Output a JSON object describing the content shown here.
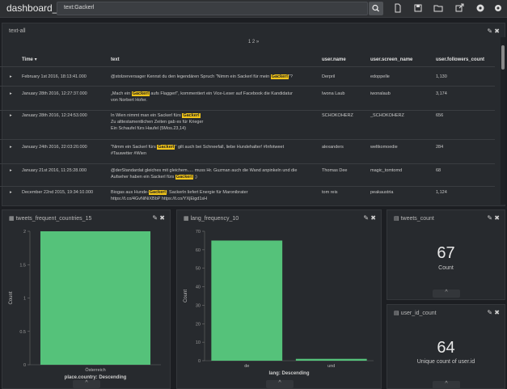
{
  "dashboard": {
    "title": "dashboard_1",
    "search_value": "text:Gackerl"
  },
  "toolbar_icons": [
    "search-icon",
    "new-document-icon",
    "save-icon",
    "open-folder-icon",
    "share-icon",
    "settings-icon",
    "gear-icon"
  ],
  "text_all": {
    "title": "text-all",
    "pager": "1  2  »",
    "columns": [
      "Time ▾",
      "text",
      "user.name",
      "user.screen_name",
      "user.followers_count"
    ],
    "rows": [
      {
        "time": "February 1st 2016, 18:13:41.000",
        "text_before": "@stolzerversager Kennst du den legendären Spruch \"Nimm ein Sackerl für mein ",
        "highlight": "Gackerl",
        "text_after": "\"?",
        "text_line2": "",
        "text_line3": "",
        "name": "Derpril",
        "screen": "edoppelle",
        "followers": "1,130"
      },
      {
        "time": "January 28th 2016, 12:27:37.000",
        "text_before": "„Mach ein ",
        "highlight": "Gackerl",
        "text_after": " aufs Flaggerl\", kommentiert ein Vice-Leser auf Facebook die Kandidatur",
        "text_line2": "von Norbert Hofer.",
        "text_line3": "",
        "name": "Iwona Laub",
        "screen": "iwonalaub",
        "followers": "3,174"
      },
      {
        "time": "January 28th 2016, 12:24:53.000",
        "text_before": "In Wien nimmt man ein Sackerl fürs ",
        "highlight": "Gackerl",
        "text_after": "",
        "text_line2": "Zu alttestamentlichen Zeiten gab es für Krieger",
        "text_line3": "Ein Schaufel fürs Haufel  (5Mos.23,14)",
        "name": "SCHOKOHERZ",
        "screen": "_SCHOKOHERZ",
        "followers": "656"
      },
      {
        "time": "January 24th 2016, 22:03:20.000",
        "text_before": "\"Nimm ein Sackerl fürs ",
        "highlight": "Gackerl",
        "text_after": "\" gilt auch bei Schneefall, liebe Hundehalter! #Infotweet",
        "text_line2": "#Tauwetter #Wien",
        "text_line3": "",
        "name": "alexanders",
        "screen": "weltkomoedie",
        "followers": "284"
      },
      {
        "time": "January 21st 2016, 11:25:28.000",
        "text_before": "@derStandardat gleiches mit gleichem..... muss Hr. Guzman auch die Wand anpinkeln und die",
        "highlight": "",
        "text_after": "",
        "text_line2": "Aufseher haben ein Sackerl fürs ",
        "line2_highlight": "Gackerl",
        "line2_after": " ;)",
        "text_line3": "",
        "name": "Thomas Dee",
        "screen": "magic_tomtomd",
        "followers": "68"
      },
      {
        "time": "December 22nd 2015, 19:34:10.000",
        "text_before": "Biogas aus Hunde-",
        "highlight": "Gackerl",
        "text_after": ": Sackerln liefert Energie für Maronibrater",
        "text_line2": "https://t.co/4GvNiNiXBbP https://t.co/YXjEigd1sH",
        "text_line3": "",
        "name": "tom reis",
        "screen": "peakaustria",
        "followers": "1,124"
      }
    ]
  },
  "countries_panel": {
    "title": "tweets_frequent_countries_15",
    "ylabel": "Count",
    "xlabel": "place.country: Descending"
  },
  "lang_panel": {
    "title": "lang_frequency_10",
    "ylabel": "Count",
    "xlabel": "lang: Descending"
  },
  "tweets_count": {
    "title": "tweets_count",
    "value": "67",
    "label": "Count"
  },
  "user_id_count": {
    "title": "user_id_count",
    "value": "64",
    "label": "Unique count of user.id"
  },
  "colors": {
    "bar": "#55c27a",
    "highlight": "#f0c419",
    "background": "#1c1e22",
    "panel": "#272a2e"
  },
  "chart_data": [
    {
      "type": "bar",
      "categories": [
        "Österreich"
      ],
      "values": [
        2
      ],
      "xlabel": "place.country: Descending",
      "ylabel": "Count",
      "yticks": [
        "0",
        "0.5",
        "1",
        "1.5",
        "2"
      ],
      "ylim": [
        0,
        2
      ]
    },
    {
      "type": "bar",
      "categories": [
        "de",
        "und"
      ],
      "values": [
        65,
        1
      ],
      "xlabel": "lang: Descending",
      "ylabel": "Count",
      "yticks": [
        "0",
        "10",
        "20",
        "30",
        "40",
        "50",
        "60",
        "70"
      ],
      "ylim": [
        0,
        70
      ]
    }
  ]
}
